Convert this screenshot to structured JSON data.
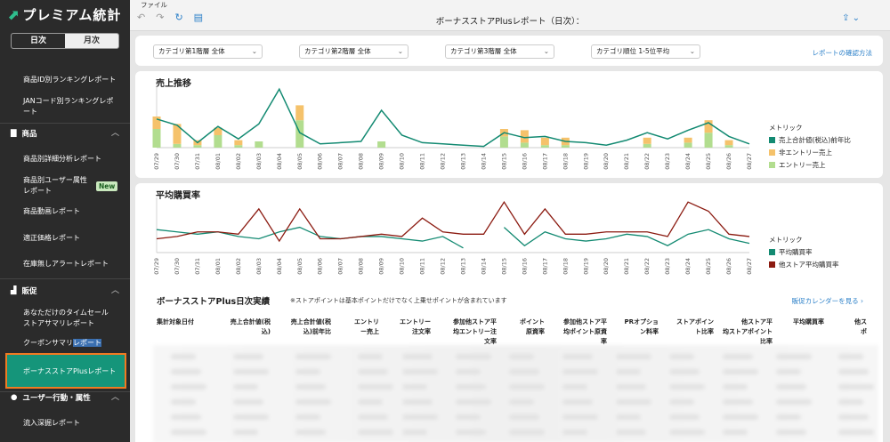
{
  "app": {
    "logo": "プレミアム統計",
    "logo_mark": "⬈"
  },
  "period_toggle": {
    "day": "日次",
    "month": "月次"
  },
  "sidebar": {
    "items_top": [
      {
        "label": "商品ID別ランキングレポート"
      },
      {
        "label": "JANコード別ランキングレポート"
      }
    ],
    "section_product": {
      "label": "商品",
      "chevron": "︿"
    },
    "product_items": [
      {
        "label": "商品別詳細分析レポート"
      },
      {
        "label": "商品別ユーザー属性レポート"
      },
      {
        "label": "商品動画レポート"
      },
      {
        "label": "適正価格レポート"
      },
      {
        "label": "在庫無しアラートレポート"
      }
    ],
    "new_badge": "New",
    "section_promo": {
      "label": "販促",
      "chevron": "︿"
    },
    "promo_items": [
      {
        "label": "あなただけのタイムセールストアサマリレポート"
      },
      {
        "label_a": "クーポンサマリ",
        "label_b": "レポート"
      },
      {
        "label": "ボーナスストアPlusレポート"
      }
    ],
    "section_user": {
      "label": "ユーザー行動・属性",
      "chevron": "︿"
    },
    "user_items": [
      {
        "label": "流入深掘レポート"
      }
    ]
  },
  "topbar": {
    "menu": "ファイル",
    "title": "ボーナスストアPlusレポート（日次）：",
    "undo_icon": "↶",
    "redo_icon": "↷",
    "refresh_icon": "↻",
    "doc_icon": "▤",
    "share_icon": "⇪ ⌄"
  },
  "filters": {
    "dropdowns": [
      {
        "label": "カテゴリ第1階層 全体"
      },
      {
        "label": "カテゴリ第2階層 全体"
      },
      {
        "label": "カテゴリ第3階層 全体"
      },
      {
        "label": "カテゴリ順位 1-5位平均"
      }
    ],
    "confirm_link": "レポートの確認方法"
  },
  "colors": {
    "green": "#138a72",
    "orange": "#f5c26b",
    "lightgreen": "#b2dd8f",
    "red": "#8b1a10",
    "accent": "#15957a"
  },
  "chart_data": [
    {
      "type": "bar",
      "title": "売上推移",
      "categories": [
        "07/29",
        "07/30",
        "07/31",
        "08/01",
        "08/02",
        "08/03",
        "08/04",
        "08/05",
        "08/06",
        "08/07",
        "08/08",
        "08/09",
        "08/10",
        "08/11",
        "08/12",
        "08/13",
        "08/14",
        "08/15",
        "08/16",
        "08/17",
        "08/18",
        "08/19",
        "08/20",
        "08/21",
        "08/22",
        "08/23",
        "08/24",
        "08/25",
        "08/26",
        "08/27"
      ],
      "legend_title": "メトリック",
      "series": [
        {
          "name": "売上合計値(税込)前年比",
          "kind": "line",
          "values": [
            23,
            18,
            4,
            17,
            7,
            19,
            47,
            12,
            3,
            4,
            5,
            30,
            10,
            4,
            3,
            2,
            1,
            12,
            8,
            9,
            5,
            4,
            2,
            6,
            12,
            7,
            14,
            20,
            9,
            3
          ]
        },
        {
          "name": "非エントリー売上",
          "kind": "bar",
          "values": [
            10,
            16,
            4,
            6,
            4,
            0,
            0,
            12,
            0,
            0,
            0,
            0,
            0,
            0,
            0,
            0,
            0,
            6,
            10,
            6,
            6,
            0,
            0,
            0,
            5,
            0,
            4,
            10,
            4,
            0
          ]
        },
        {
          "name": "エントリー売上",
          "kind": "bar",
          "values": [
            15,
            3,
            2,
            10,
            2,
            5,
            0,
            22,
            0,
            0,
            0,
            5,
            0,
            0,
            0,
            0,
            0,
            9,
            4,
            2,
            2,
            0,
            0,
            0,
            3,
            0,
            4,
            12,
            2,
            0
          ]
        }
      ]
    },
    {
      "type": "line",
      "title": "平均購買率",
      "categories": [
        "07/29",
        "07/30",
        "07/31",
        "08/01",
        "08/02",
        "08/03",
        "08/04",
        "08/05",
        "08/06",
        "08/07",
        "08/08",
        "08/09",
        "08/10",
        "08/11",
        "08/12",
        "08/13",
        "08/14",
        "08/15",
        "08/16",
        "08/17",
        "08/18",
        "08/19",
        "08/20",
        "08/21",
        "08/22",
        "08/23",
        "08/24",
        "08/25",
        "08/26",
        "08/27"
      ],
      "legend_title": "メトリック",
      "series": [
        {
          "name": "平均購買率",
          "values": [
            10,
            9,
            8,
            9,
            7,
            6,
            9,
            11,
            7,
            6,
            7,
            7,
            6,
            5,
            7,
            2,
            null,
            11,
            3,
            9,
            6,
            5,
            6,
            8,
            7,
            3,
            8,
            10,
            6,
            4
          ]
        },
        {
          "name": "他ストア平均購買率",
          "values": [
            6,
            7,
            9,
            9,
            8,
            19,
            5,
            19,
            6,
            6,
            7,
            8,
            7,
            15,
            9,
            8,
            8,
            22,
            8,
            19,
            8,
            8,
            9,
            9,
            9,
            7,
            22,
            18,
            8,
            7
          ]
        }
      ]
    }
  ],
  "table": {
    "title": "ボーナスストアPlus日次実績",
    "note": "※ストアポイントは基本ポイントだけでなく上乗せポイントが含まれています",
    "link": "販促カレンダーを見る ›",
    "headers": [
      "集計対象日付",
      "売上合計値(税\n込)",
      "売上合計値(税\n込)前年比",
      "エントリ\nー売上",
      "エントリー\n注文率",
      "参加他ストア平\n均エントリー注\n文率",
      "ポイント\n原資率",
      "参加他ストア平\n均ポイント原資\n率",
      "PRオプショ\nン料率",
      "ストアポイン\nト比率",
      "他ストア平\n均ストアポイント\n比率",
      "平均購買率",
      "他ス\nポ"
    ]
  }
}
